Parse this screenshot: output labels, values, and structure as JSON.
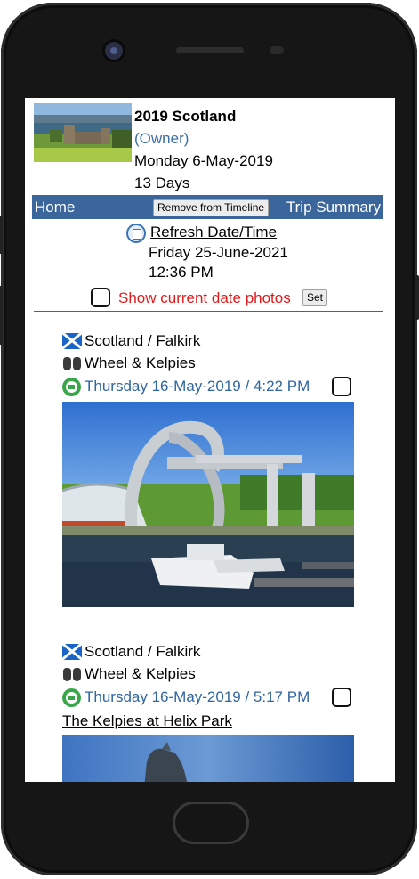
{
  "trip": {
    "title": "2019 Scotland",
    "role": "(Owner)",
    "start_date": "Monday 6-May-2019",
    "duration": "13 Days"
  },
  "nav": {
    "home": "Home",
    "remove_button": "Remove from Timeline",
    "trip_summary": "Trip Summary"
  },
  "refresh": {
    "link": "Refresh Date/Time",
    "date": "Friday 25-June-2021",
    "time": "12:36 PM",
    "icon": "calendar-icon"
  },
  "show_current": {
    "label": "Show current date photos",
    "set_button": "Set",
    "checked": false
  },
  "entries": [
    {
      "location": "Scotland / Falkirk",
      "place": "Wheel & Kelpies",
      "datetime": "Thursday 16-May-2019 / 4:22 PM",
      "caption": "",
      "checked": false
    },
    {
      "location": "Scotland / Falkirk",
      "place": "Wheel & Kelpies",
      "datetime": "Thursday 16-May-2019 / 5:17 PM",
      "caption": "The Kelpies at Helix Park",
      "checked": false
    }
  ],
  "colors": {
    "nav_bar": "#3b669c",
    "link_blue": "#2f65a0",
    "alert_red": "#e01b1b",
    "go_green": "#3aa64a"
  }
}
